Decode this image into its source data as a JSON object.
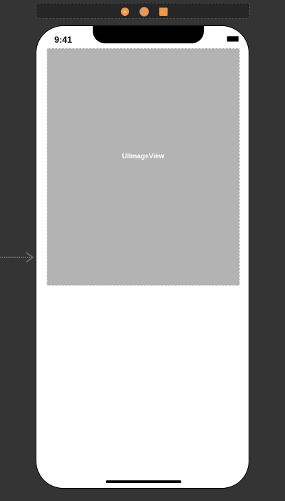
{
  "scene_dock": {
    "icons": [
      "view-controller-icon",
      "first-responder-icon",
      "exit-icon"
    ],
    "accent": "#f0994a"
  },
  "status_bar": {
    "time": "9:41"
  },
  "image_view": {
    "label": "UIImageView"
  }
}
